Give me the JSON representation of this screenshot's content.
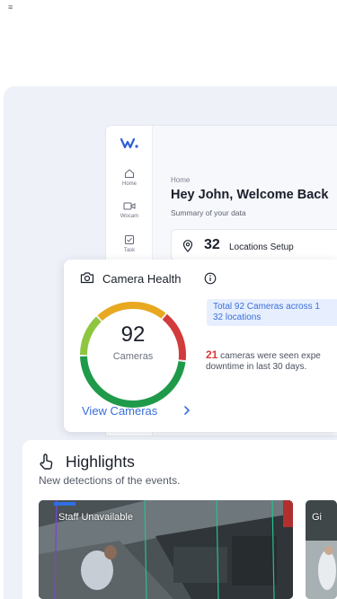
{
  "app": {
    "nav": [
      {
        "label": "Home",
        "icon": "home-icon"
      },
      {
        "label": "Wocam",
        "icon": "video-camera-icon"
      },
      {
        "label": "Task",
        "icon": "task-checkbox-icon"
      }
    ],
    "breadcrumb": "Home",
    "welcome": "Hey John, Welcome Back",
    "summary": "Summary of your data",
    "locations": {
      "count": "32",
      "label": "Locations Setup"
    }
  },
  "camera_health": {
    "title": "Camera Health",
    "total_cameras": "92",
    "cameras_label": "Cameras",
    "total_text_line1": "Total 92 Cameras across 1",
    "total_text_line2": "32 locations",
    "downtime_count": "21",
    "downtime_text_line1": " cameras were seen expe",
    "downtime_text_line2": "downtime in last 30 days.",
    "view_link": "View Cameras",
    "gauge_colors": [
      "#e8a820",
      "#d23b3b",
      "#1f9a4a",
      "#8fc63f"
    ]
  },
  "highlights": {
    "title": "Highlights",
    "subtitle": "New detections of the events.",
    "items": [
      {
        "label": "Staff Unavailable"
      },
      {
        "label": "Gi"
      }
    ]
  },
  "colors": {
    "accent": "#3a6fd8",
    "danger": "#d93a3a",
    "background": "#eef1f8"
  }
}
